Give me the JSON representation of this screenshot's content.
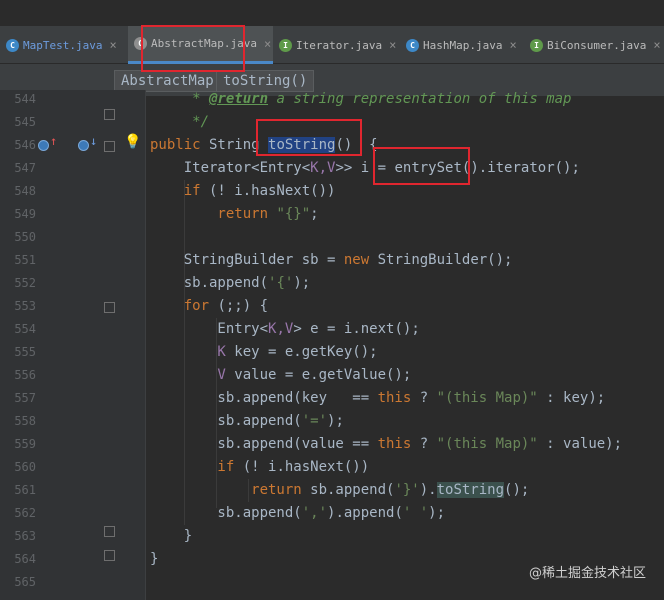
{
  "tabs": [
    {
      "label": "MapTest.java",
      "icon": "class-icon",
      "active": false
    },
    {
      "label": "AbstractMap.java",
      "icon": "abstract-class-icon",
      "active": true
    },
    {
      "label": "Iterator.java",
      "icon": "interface-icon",
      "active": false
    },
    {
      "label": "HashMap.java",
      "icon": "class-icon",
      "active": false
    },
    {
      "label": "BiConsumer.java",
      "icon": "interface-icon",
      "active": false
    }
  ],
  "tab_close_glyph": "×",
  "breadcrumb": {
    "class_name": "AbstractMap",
    "method_name": "toString()"
  },
  "line_numbers": [
    "544",
    "545",
    "546",
    "547",
    "548",
    "549",
    "550",
    "551",
    "552",
    "553",
    "554",
    "555",
    "556",
    "557",
    "558",
    "559",
    "560",
    "561",
    "562",
    "563",
    "564",
    "565"
  ],
  "code": {
    "l544_star": "     * ",
    "l544_tag": "@return",
    "l544_text": " a string representation of this map",
    "l545": "     */",
    "l546_kw": "public",
    "l546_type": " String ",
    "l546_method": "toString",
    "l546_rest": "()  {",
    "l547_a": "    Iterator<Entry<",
    "l547_gen": "K,V",
    "l547_b": ">> i = ",
    "l547_call": "entrySet()",
    "l547_c": ".iterator();",
    "l548_kw": "    if",
    "l548_rest": " (! i.hasNext())",
    "l549_kw": "        return",
    "l549_str": " \"{}\"",
    "l549_end": ";",
    "l551_a": "    StringBuilder sb = ",
    "l551_kw": "new",
    "l551_b": " StringBuilder();",
    "l552_a": "    sb.append(",
    "l552_str": "'{'",
    "l552_b": ");",
    "l553_kw": "    for",
    "l553_rest": " (;;) {",
    "l554_a": "        Entry<",
    "l554_gen": "K,V",
    "l554_b": "> e = i.next();",
    "l555_gen": "        K",
    "l555_rest": " key = e.getKey();",
    "l556_gen": "        V",
    "l556_rest": " value = e.getValue();",
    "l557_a": "        sb.append(key   == ",
    "l557_kw": "this",
    "l557_b": " ? ",
    "l557_str": "\"(this Map)\"",
    "l557_c": " : key);",
    "l558_a": "        sb.append(",
    "l558_str": "'='",
    "l558_b": ");",
    "l559_a": "        sb.append(value == ",
    "l559_kw": "this",
    "l559_b": " ? ",
    "l559_str": "\"(this Map)\"",
    "l559_c": " : value);",
    "l560_kw": "        if",
    "l560_rest": " (! i.hasNext())",
    "l561_kw": "            return",
    "l561_a": " sb.append(",
    "l561_str": "'}'",
    "l561_b": ").",
    "l561_call": "toString",
    "l561_c": "();",
    "l562_a": "        sb.append(",
    "l562_str1": "','",
    "l562_b": ").append(",
    "l562_str2": "' '",
    "l562_c": ");",
    "l563": "    }",
    "l564": "}"
  },
  "watermark": "@稀土掘金技术社区",
  "colors": {
    "keyword": "#cc7832",
    "string": "#6a8759",
    "generic": "#9876aa",
    "comment": "#629755",
    "text": "#a9b7c6",
    "annotation_box": "#e0262f"
  }
}
